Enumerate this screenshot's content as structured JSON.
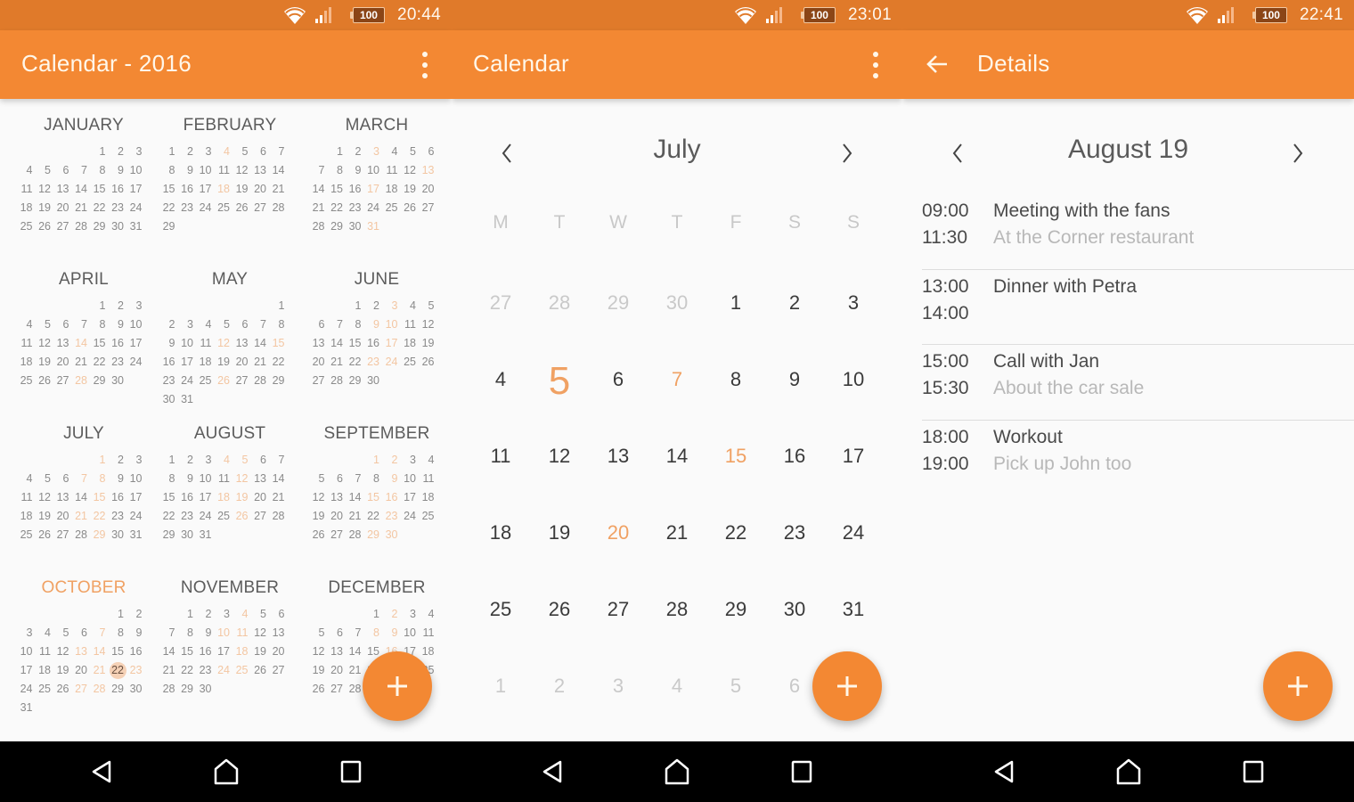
{
  "colors": {
    "accent": "#f38833",
    "statusbar": "#e07a2a",
    "event_highlight": "#f3c6a2",
    "text_primary": "#4a4a4a",
    "text_muted": "#b8b8b8"
  },
  "screens": [
    {
      "status": {
        "battery": "100",
        "time": "20:44",
        "icons": [
          "wifi-icon",
          "signal-icon",
          "battery-icon"
        ]
      },
      "appbar": {
        "title": "Calendar - 2016",
        "action": "more-vert-icon"
      },
      "year": 2016,
      "months": [
        {
          "name": "JANUARY",
          "offset": 4,
          "days": 31,
          "events": []
        },
        {
          "name": "FEBRUARY",
          "offset": 0,
          "days": 29,
          "events": [
            4,
            18
          ]
        },
        {
          "name": "MARCH",
          "offset": 1,
          "days": 31,
          "events": [
            3,
            13,
            17,
            31
          ]
        },
        {
          "name": "APRIL",
          "offset": 4,
          "days": 30,
          "events": [
            14,
            28
          ]
        },
        {
          "name": "MAY",
          "offset": 6,
          "days": 31,
          "events": [
            12,
            15,
            26
          ]
        },
        {
          "name": "JUNE",
          "offset": 2,
          "days": 30,
          "events": [
            3,
            9,
            10,
            17,
            23,
            24
          ]
        },
        {
          "name": "JULY",
          "offset": 4,
          "days": 31,
          "events": [
            1,
            7,
            8,
            15,
            21,
            22,
            29
          ]
        },
        {
          "name": "AUGUST",
          "offset": 0,
          "days": 31,
          "events": [
            4,
            5,
            12,
            18,
            19,
            26
          ]
        },
        {
          "name": "SEPTEMBER",
          "offset": 3,
          "days": 30,
          "events": [
            1,
            2,
            9,
            15,
            16,
            23,
            29,
            30
          ]
        },
        {
          "name": "OCTOBER",
          "offset": 5,
          "days": 31,
          "events": [
            7,
            13,
            14,
            21,
            23,
            27,
            28
          ],
          "today": 22,
          "current": true
        },
        {
          "name": "NOVEMBER",
          "offset": 1,
          "days": 30,
          "events": [
            4,
            10,
            11,
            18,
            24,
            25
          ]
        },
        {
          "name": "DECEMBER",
          "offset": 3,
          "days": 31,
          "events": [
            2,
            8,
            9,
            16
          ]
        }
      ],
      "fab": "add-icon"
    },
    {
      "status": {
        "battery": "100",
        "time": "23:01"
      },
      "appbar": {
        "title": "Calendar",
        "action": "more-vert-icon"
      },
      "month_title": "July",
      "weekdays": [
        "M",
        "T",
        "W",
        "T",
        "F",
        "S",
        "S"
      ],
      "weeks": [
        [
          {
            "d": "27",
            "t": "other"
          },
          {
            "d": "28",
            "t": "other"
          },
          {
            "d": "29",
            "t": "other"
          },
          {
            "d": "30",
            "t": "other"
          },
          {
            "d": "1"
          },
          {
            "d": "2"
          },
          {
            "d": "3"
          }
        ],
        [
          {
            "d": "4"
          },
          {
            "d": "5",
            "t": "today"
          },
          {
            "d": "6"
          },
          {
            "d": "7",
            "t": "ev"
          },
          {
            "d": "8"
          },
          {
            "d": "9"
          },
          {
            "d": "10"
          }
        ],
        [
          {
            "d": "11"
          },
          {
            "d": "12"
          },
          {
            "d": "13"
          },
          {
            "d": "14"
          },
          {
            "d": "15",
            "t": "ev"
          },
          {
            "d": "16"
          },
          {
            "d": "17"
          }
        ],
        [
          {
            "d": "18"
          },
          {
            "d": "19"
          },
          {
            "d": "20",
            "t": "ev"
          },
          {
            "d": "21"
          },
          {
            "d": "22"
          },
          {
            "d": "23"
          },
          {
            "d": "24"
          }
        ],
        [
          {
            "d": "25"
          },
          {
            "d": "26"
          },
          {
            "d": "27"
          },
          {
            "d": "28"
          },
          {
            "d": "29"
          },
          {
            "d": "30"
          },
          {
            "d": "31"
          }
        ],
        [
          {
            "d": "1",
            "t": "other"
          },
          {
            "d": "2",
            "t": "other"
          },
          {
            "d": "3",
            "t": "other"
          },
          {
            "d": "4",
            "t": "other"
          },
          {
            "d": "5",
            "t": "other"
          },
          {
            "d": "6",
            "t": "other"
          },
          {
            "d": "7",
            "t": "other"
          }
        ]
      ],
      "fab": "add-icon"
    },
    {
      "status": {
        "battery": "100",
        "time": "22:41"
      },
      "appbar": {
        "title": "Details",
        "nav": "back-arrow-icon"
      },
      "date_title": "August 19",
      "events": [
        {
          "start": "09:00",
          "end": "11:30",
          "title": "Meeting with the fans",
          "subtitle": "At the Corner restaurant"
        },
        {
          "start": "13:00",
          "end": "14:00",
          "title": "Dinner with Petra",
          "subtitle": ""
        },
        {
          "start": "15:00",
          "end": "15:30",
          "title": "Call with Jan",
          "subtitle": "About the car sale"
        },
        {
          "start": "18:00",
          "end": "19:00",
          "title": "Workout",
          "subtitle": "Pick up John too"
        }
      ],
      "fab": "add-icon"
    }
  ],
  "navbar": {
    "buttons": [
      "back",
      "home",
      "recents"
    ]
  }
}
